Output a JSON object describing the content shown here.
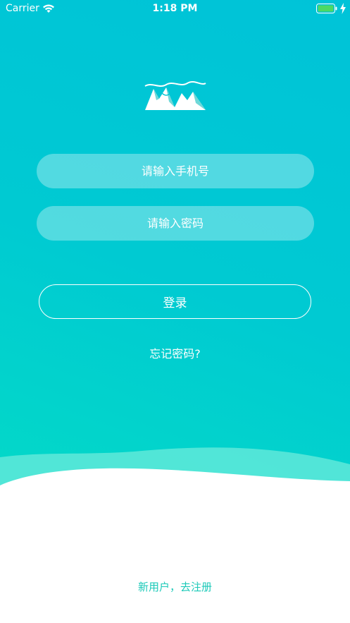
{
  "status_bar": {
    "carrier": "Carrier",
    "time": "1:18 PM",
    "battery_color": "#4cd964"
  },
  "logo": {
    "icon": "mountain-logo-icon"
  },
  "login_form": {
    "phone_placeholder": "请输入手机号",
    "password_placeholder": "请输入密码",
    "login_label": "登录",
    "forgot_password": "忘记密码?"
  },
  "footer": {
    "register_link": "新用户，去注册"
  },
  "colors": {
    "gradient_top": "#00c3d8",
    "gradient_bottom": "#05e0c3",
    "register_text": "#1bc9b8"
  }
}
